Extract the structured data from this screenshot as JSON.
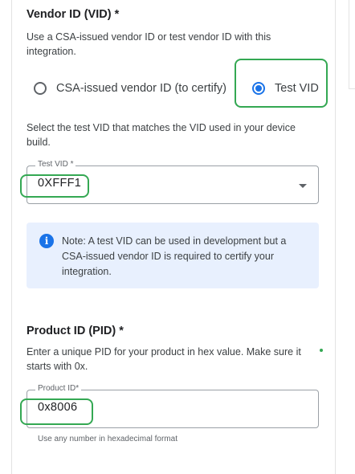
{
  "vendor_section": {
    "heading": "Vendor ID (VID) *",
    "description": "Use a CSA-issued vendor ID or test vendor ID with this integration.",
    "radios": [
      {
        "label": "CSA-issued vendor ID (to certify)",
        "selected": false
      },
      {
        "label": "Test VID",
        "selected": true
      }
    ],
    "select_instruction": "Select the test VID that matches the VID used in your device build.",
    "test_vid_field": {
      "label": "Test VID *",
      "value": "0XFFF1"
    },
    "note": "Note: A test VID can be used in development but a CSA-issued vendor ID is required to certify your integration."
  },
  "product_section": {
    "heading": "Product ID (PID) *",
    "description": "Enter a unique PID for your product in hex value. Make sure it starts with 0x.",
    "pid_field": {
      "label": "Product ID*",
      "value": "0x8006"
    },
    "hint": "Use any number in hexadecimal format"
  },
  "colors": {
    "accent": "#1a73e8",
    "highlight": "#34a853",
    "note_background": "#e8f0fe"
  }
}
